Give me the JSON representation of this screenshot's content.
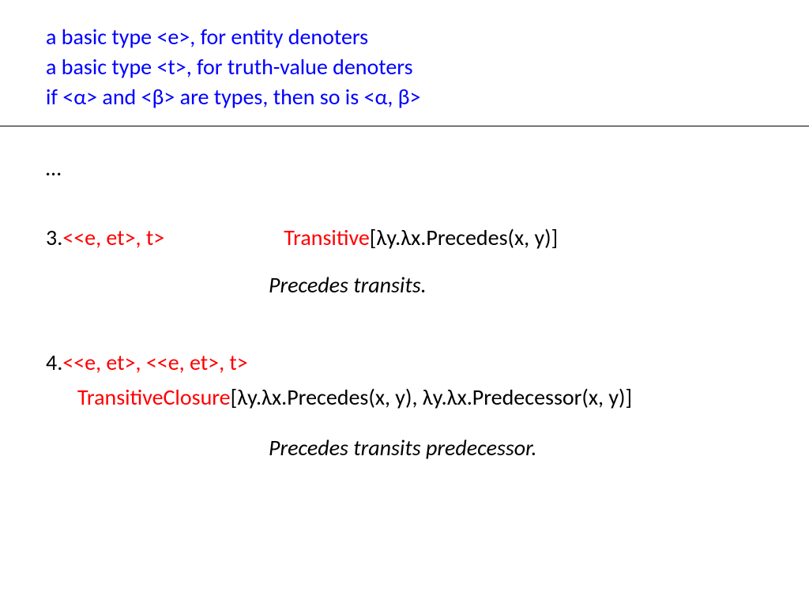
{
  "header": {
    "line1": "a basic type <e>, for entity denoters",
    "line2": "a basic type <t>, for truth-value denoters",
    "line3": "if <α> and <β> are types, then so is <α, β>"
  },
  "content": {
    "ellipsis": "…",
    "item3": {
      "num": "3.  ",
      "type": "<<e, et>, t>",
      "fn": "Transitive",
      "arg": "[λy.λx.Precedes(x, y)]",
      "caption": "Precedes transits."
    },
    "item4": {
      "num": "4. ",
      "type": "<<e, et>, <<e, et>, t>",
      "fn": "TransitiveClosure",
      "arg": "[λy.λx.Precedes(x, y), λy.λx.Predecessor(x, y)]",
      "caption": "Precedes transits predecessor."
    }
  }
}
